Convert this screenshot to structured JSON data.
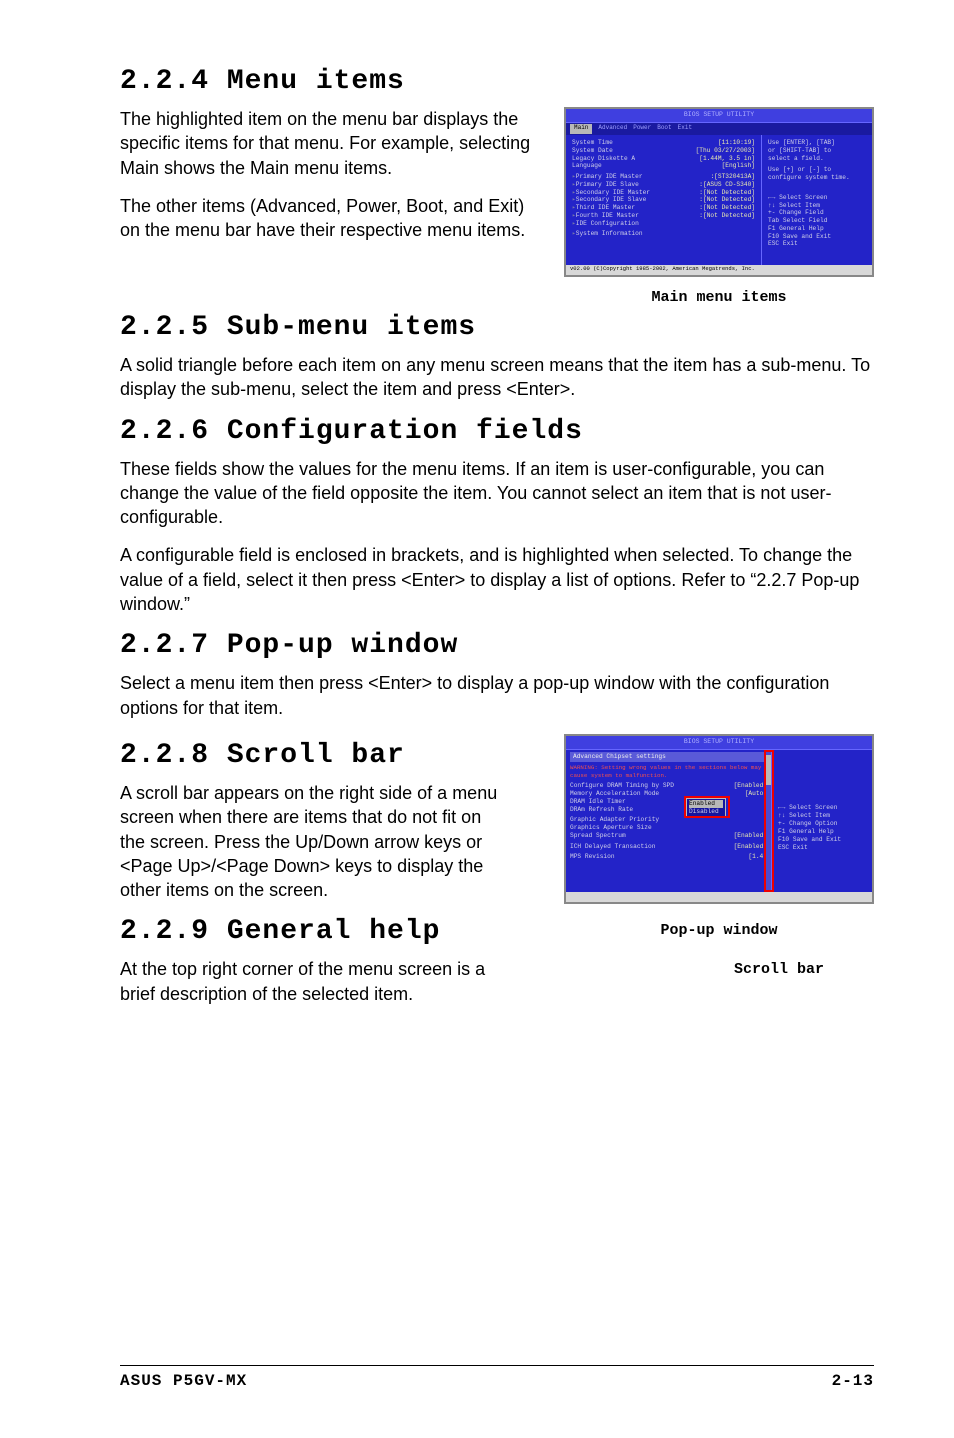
{
  "sections": {
    "s224": {
      "heading": "2.2.4  Menu items",
      "p1": "The highlighted item on the menu bar displays the specific items for that menu. For example, selecting Main shows the Main menu items.",
      "p2": "The other items (Advanced, Power, Boot, and Exit) on the menu bar have their respective menu items."
    },
    "s225": {
      "heading": "2.2.5  Sub-menu items",
      "p1": "A solid triangle before each item on any menu screen means that the item has a sub-menu. To display the sub-menu, select the item and press <Enter>."
    },
    "s226": {
      "heading": "2.2.6  Configuration fields",
      "p1": "These fields show the values for the menu items. If an item is user-configurable, you can change the value of the field opposite the item. You cannot select an item that is not user-configurable.",
      "p2": "A configurable field is enclosed in brackets, and is highlighted when selected. To change the value of a field, select it then press <Enter> to display a list of options. Refer to “2.2.7 Pop-up window.”"
    },
    "s227": {
      "heading": "2.2.7  Pop-up window",
      "p1": "Select a menu item then press <Enter> to display a pop-up window with the configuration options for that item."
    },
    "s228": {
      "heading": "2.2.8  Scroll bar",
      "p1": "A scroll bar appears on the right side of a menu screen when there are items that do not fit on the screen. Press the Up/Down arrow keys or <Page Up>/<Page Down> keys to display the other items on the screen."
    },
    "s229": {
      "heading": "2.2.9  General help",
      "p1": "At the top right corner of the menu screen is a brief description of the selected item."
    }
  },
  "captions": {
    "main_menu": "Main menu items",
    "popup": "Pop-up window",
    "scrollbar": "Scroll bar"
  },
  "bios1": {
    "title": "BIOS SETUP UTILITY",
    "menubar": [
      "Main",
      "Advanced",
      "Power",
      "Boot",
      "Exit"
    ],
    "menubar_selected": "Main",
    "rows": [
      {
        "k": "System Time",
        "v": "[11:10:19]"
      },
      {
        "k": "System Date",
        "v": "[Thu 03/27/2003]"
      },
      {
        "k": "Legacy Diskette A",
        "v": "[1.44M, 3.5 in]"
      },
      {
        "k": "Language",
        "v": "[English]"
      }
    ],
    "subs": [
      {
        "k": "Primary IDE Master",
        "v": ":[ST320413A]"
      },
      {
        "k": "Primary IDE Slave",
        "v": ":[ASUS CD-S340]"
      },
      {
        "k": "Secondary IDE Master",
        "v": ":[Not Detected]"
      },
      {
        "k": "Secondary IDE Slave",
        "v": ":[Not Detected]"
      },
      {
        "k": "Third IDE Master",
        "v": ":[Not Detected]"
      },
      {
        "k": "Fourth IDE Master",
        "v": ":[Not Detected]"
      },
      {
        "k": "IDE Configuration",
        "v": ""
      },
      {
        "k": "System Information",
        "v": ""
      }
    ],
    "help_top": [
      "Use [ENTER], [TAB]",
      "or [SHIFT-TAB] to",
      "select a field.",
      "",
      "Use [+] or [-] to",
      "configure system time."
    ],
    "help_nav": [
      "←→  Select Screen",
      "↑↓  Select Item",
      "+-   Change Field",
      "Tab  Select Field",
      "F1   General Help",
      "F10  Save and Exit",
      "ESC  Exit"
    ],
    "footer": "v02.00 (C)Copyright 1985-2002, American Megatrends, Inc."
  },
  "bios2": {
    "title": "BIOS SETUP UTILITY",
    "menubar_selected": "Advanced",
    "subtitle": "Advanced Chipset settings",
    "warning": "WARNING: Setting wrong values in the sections below may cause system to malfunction.",
    "rows": [
      {
        "k": "Configure DRAM Timing by SPD",
        "v": "[Enabled]"
      },
      {
        "k": "Memory Acceleration Mode",
        "v": "[Auto]"
      },
      {
        "k": "DRAM Idle Timer",
        "v": ""
      },
      {
        "k": "DRAm Refresh Rate",
        "v": ""
      },
      {
        "k": "Graphic Adapter Priority",
        "v": ""
      },
      {
        "k": "Graphics Aperture Size",
        "v": ""
      },
      {
        "k": "Spread Spectrum",
        "v": "[Enabled]"
      },
      {
        "k": "ICH Delayed Transaction",
        "v": "[Enabled]"
      },
      {
        "k": "MPS Revision",
        "v": "[1.4]"
      }
    ],
    "popup_options": [
      "Enabled",
      "Disabled"
    ],
    "popup_selected": "Enabled",
    "help_nav": [
      "←→  Select Screen",
      "↑↓  Select Item",
      "+-   Change Option",
      "F1   General Help",
      "F10  Save and Exit",
      "ESC  Exit"
    ]
  },
  "footer": {
    "product": "ASUS P5GV-MX",
    "page": "2-13"
  }
}
